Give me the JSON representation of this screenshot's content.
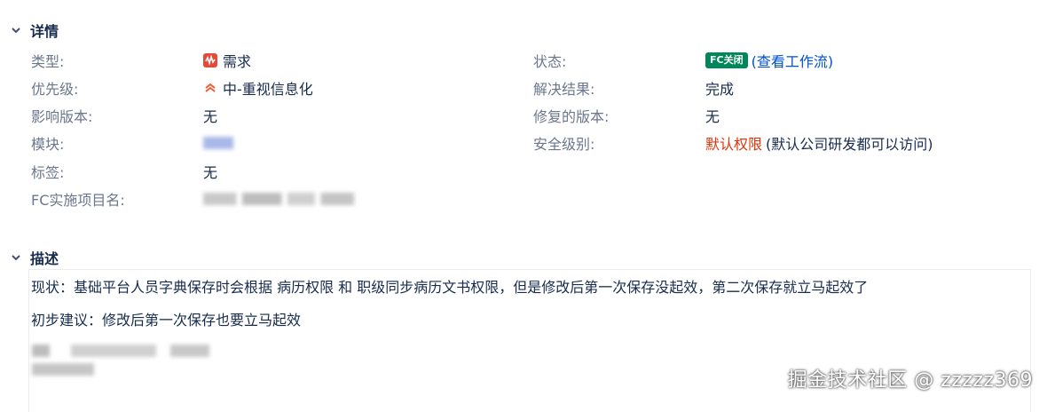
{
  "details": {
    "title": "详情",
    "left": [
      {
        "label": "类型:",
        "value": "需求"
      },
      {
        "label": "优先级:",
        "value": "中-重视信息化"
      },
      {
        "label": "影响版本:",
        "value": "无"
      },
      {
        "label": "模块:",
        "value": ""
      },
      {
        "label": "标签:",
        "value": "无"
      },
      {
        "label": "FC实施项目名:",
        "value": ""
      }
    ],
    "right": {
      "status_label": "状态:",
      "status_badge": "FC关闭",
      "status_link": "(查看工作流)",
      "resolution_label": "解决结果:",
      "resolution_value": "完成",
      "fix_version_label": "修复的版本:",
      "fix_version_value": "无",
      "security_label": "安全级别:",
      "security_value": "默认权限",
      "security_note": "(默认公司研发都可以访问)"
    }
  },
  "description": {
    "title": "描述",
    "line1": "现状：基础平台人员字典保存时会根据 病历权限 和 职级同步病历文书权限，但是修改后第一次保存没起效，第二次保存就立马起效了",
    "line2": "初步建议：修改后第一次保存也要立马起效"
  },
  "watermark": "掘金技术社区 @ zzzzz369",
  "colors": {
    "type_icon": "#e5493a",
    "priority_icon": "#f15c37",
    "badge": "#00875a",
    "link": "#0052cc",
    "security": "#de350b"
  }
}
